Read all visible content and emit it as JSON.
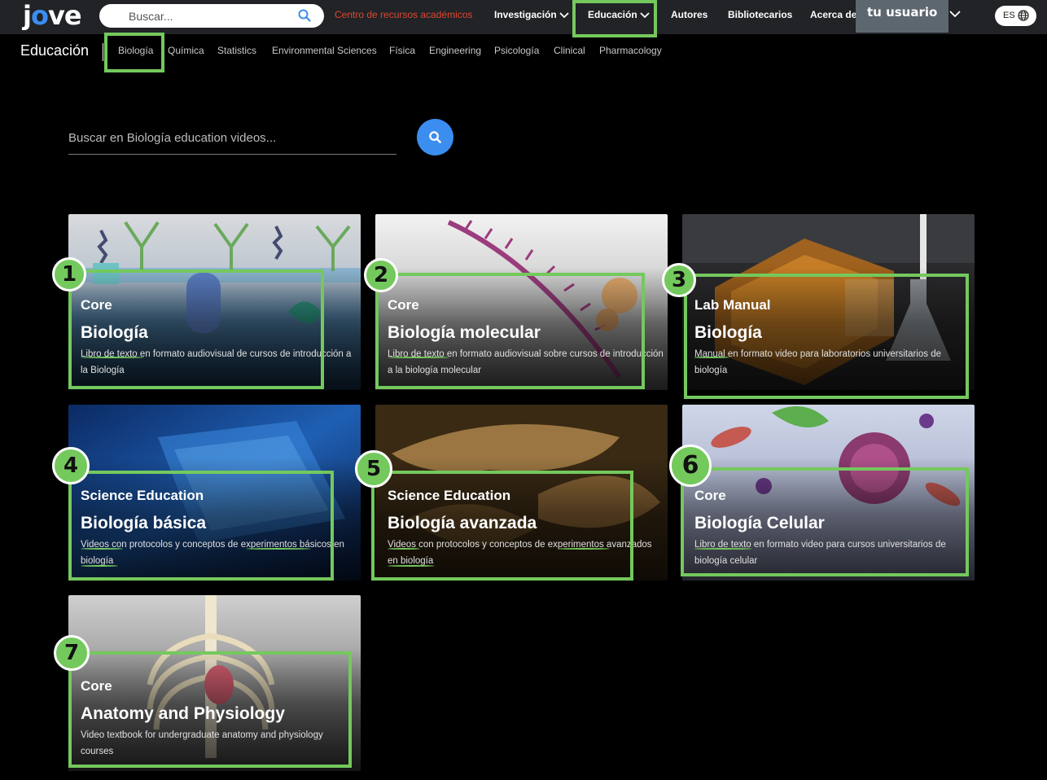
{
  "header": {
    "logo": "jove",
    "search_placeholder": "Buscar...",
    "resources_link": "Centro de recursos académicos",
    "nav": [
      "Investigación",
      "Educación",
      "Autores",
      "Bibliotecarios",
      "Acerca de"
    ],
    "user": "tu usuario",
    "lang": "ES"
  },
  "subnav": {
    "title": "Educación",
    "items": [
      "Biología",
      "Química",
      "Statistics",
      "Environmental Sciences",
      "Física",
      "Engineering",
      "Psicología",
      "Clinical",
      "Pharmacology"
    ]
  },
  "edu_search": {
    "placeholder": "Buscar en Biología education videos..."
  },
  "cards": [
    {
      "kind": "Core",
      "title": "Biología",
      "desc": "Libro de texto en formato audiovisual de cursos de introducción a la Biología",
      "badge": "1"
    },
    {
      "kind": "Core",
      "title": "Biología molecular",
      "desc": "Libro de texto en formato audiovisual sobre cursos de introducción a la biología molecular",
      "badge": "2"
    },
    {
      "kind": "Lab Manual",
      "title": "Biología",
      "desc": "Manual en formato video para laboratorios universitarios de biología",
      "badge": "3"
    },
    {
      "kind": "Science Education",
      "title": "Biología básica",
      "desc": "Videos con protocolos y conceptos de experimentos básicos en biología",
      "badge": "4"
    },
    {
      "kind": "Science Education",
      "title": "Biología avanzada",
      "desc": "Videos con protocolos y conceptos de experimentos avanzados en biología",
      "badge": "5"
    },
    {
      "kind": "Core",
      "title": "Biología Celular",
      "desc": "Libro de texto en formato video para cursos universitarios de biología celular",
      "badge": "6"
    },
    {
      "kind": "Core",
      "title": "Anatomy and Physiology",
      "desc": "Video textbook for undergraduate anatomy and physiology courses",
      "badge": "7"
    }
  ],
  "colors": {
    "annotation": "#74c95d",
    "accent_blue": "#3b8df0",
    "resources_red": "#e2462e",
    "topbar": "#212327"
  }
}
